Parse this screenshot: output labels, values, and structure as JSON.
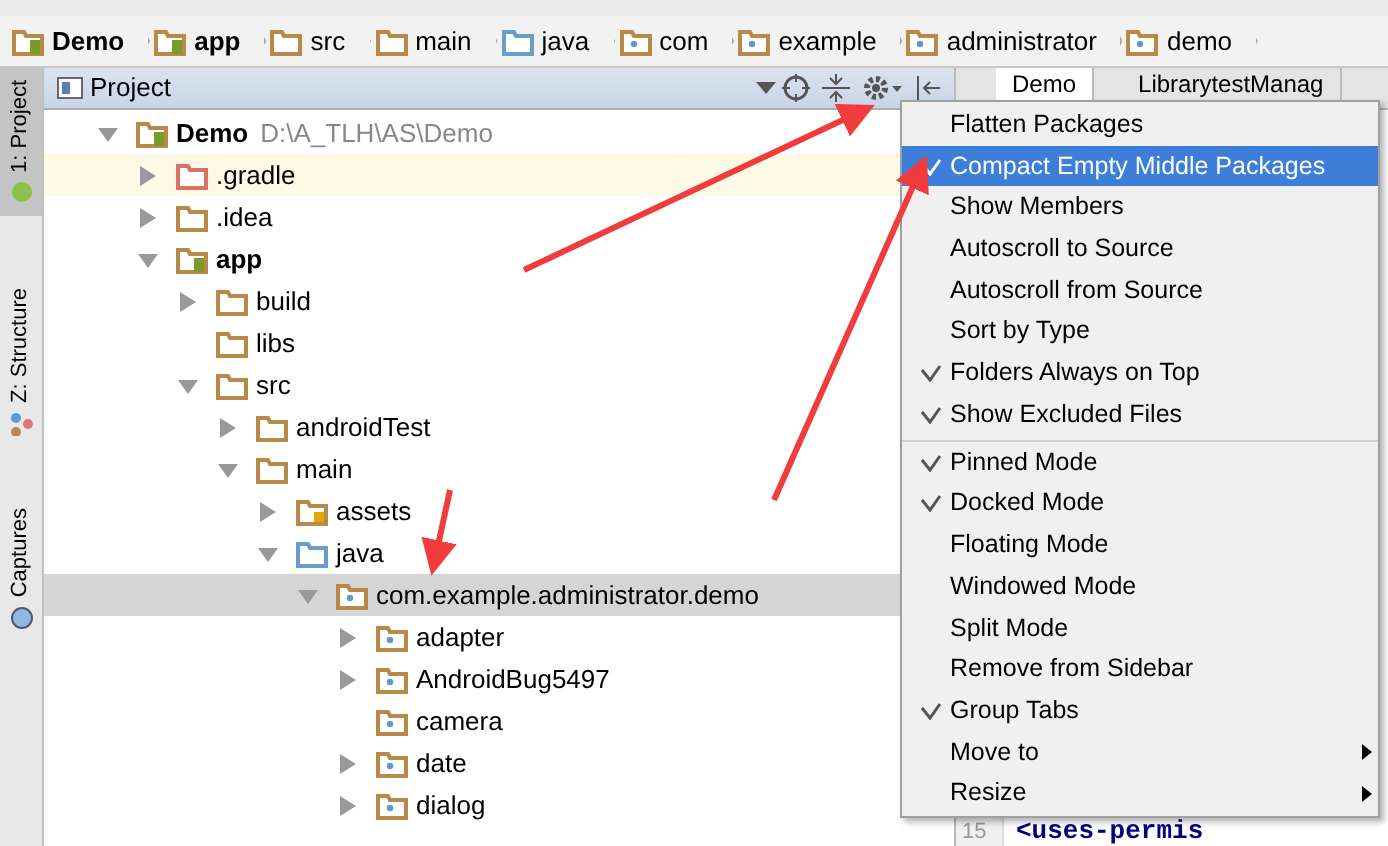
{
  "breadcrumbs": [
    {
      "label": "Demo",
      "kind": "module",
      "bold": true
    },
    {
      "label": "app",
      "kind": "module",
      "bold": true
    },
    {
      "label": "src",
      "kind": "folder",
      "bold": false
    },
    {
      "label": "main",
      "kind": "folder",
      "bold": false
    },
    {
      "label": "java",
      "kind": "source",
      "bold": false
    },
    {
      "label": "com",
      "kind": "package",
      "bold": false
    },
    {
      "label": "example",
      "kind": "package",
      "bold": false
    },
    {
      "label": "administrator",
      "kind": "package",
      "bold": false
    },
    {
      "label": "demo",
      "kind": "package",
      "bold": false
    }
  ],
  "tool_strip": [
    {
      "label": "1: Project",
      "kind": "android",
      "selected": true
    },
    {
      "label": "Z: Structure",
      "kind": "structure",
      "selected": false
    },
    {
      "label": "Captures",
      "kind": "captures",
      "selected": false
    }
  ],
  "project_panel": {
    "title": "Project",
    "tree": [
      {
        "label": "Demo",
        "path": "D:\\A_TLH\\AS\\Demo",
        "kind": "module",
        "bold": true,
        "expanded": true,
        "selected": false,
        "highlighted": false,
        "children": [
          {
            "label": ".gradle",
            "kind": "excluded",
            "bold": false,
            "expanded": false,
            "selected": false,
            "highlighted": true
          },
          {
            "label": ".idea",
            "kind": "folder",
            "bold": false,
            "expanded": false,
            "selected": false,
            "highlighted": false
          },
          {
            "label": "app",
            "kind": "module",
            "bold": true,
            "expanded": true,
            "selected": false,
            "highlighted": false,
            "children": [
              {
                "label": "build",
                "kind": "folder",
                "bold": false,
                "expanded": false,
                "selected": false,
                "highlighted": false
              },
              {
                "label": "libs",
                "kind": "folder",
                "bold": false,
                "selected": false,
                "highlighted": false
              },
              {
                "label": "src",
                "kind": "folder",
                "bold": false,
                "expanded": true,
                "selected": false,
                "highlighted": false,
                "children": [
                  {
                    "label": "androidTest",
                    "kind": "folder",
                    "bold": false,
                    "expanded": false,
                    "selected": false,
                    "highlighted": false
                  },
                  {
                    "label": "main",
                    "kind": "folder",
                    "bold": false,
                    "expanded": true,
                    "selected": false,
                    "highlighted": false,
                    "children": [
                      {
                        "label": "assets",
                        "kind": "assets",
                        "bold": false,
                        "expanded": false,
                        "selected": false,
                        "highlighted": false
                      },
                      {
                        "label": "java",
                        "kind": "source",
                        "bold": false,
                        "expanded": true,
                        "selected": false,
                        "highlighted": false,
                        "children": [
                          {
                            "label": "com.example.administrator.demo",
                            "kind": "package",
                            "bold": false,
                            "expanded": true,
                            "selected": true,
                            "highlighted": false,
                            "children": [
                              {
                                "label": "adapter",
                                "kind": "package",
                                "bold": false,
                                "expanded": false,
                                "selected": false,
                                "highlighted": false
                              },
                              {
                                "label": "AndroidBug5497",
                                "kind": "package",
                                "bold": false,
                                "expanded": false,
                                "selected": false,
                                "highlighted": false
                              },
                              {
                                "label": "camera",
                                "kind": "package",
                                "bold": false,
                                "selected": false,
                                "highlighted": false
                              },
                              {
                                "label": "date",
                                "kind": "package",
                                "bold": false,
                                "expanded": false,
                                "selected": false,
                                "highlighted": false
                              },
                              {
                                "label": "dialog",
                                "kind": "package",
                                "bold": false,
                                "expanded": false,
                                "selected": false,
                                "highlighted": false
                              }
                            ]
                          }
                        ]
                      }
                    ]
                  }
                ]
              }
            ]
          }
        ]
      }
    ]
  },
  "editor": {
    "tabs": [
      {
        "label": "Demo",
        "selected": true
      },
      {
        "label": "LibrarytestManag",
        "selected": false
      }
    ],
    "line_number": "15",
    "code_line": "<uses-permis"
  },
  "menu": [
    {
      "label": "Flatten Packages",
      "checked": false,
      "selected": false,
      "separator_before": false,
      "submenu": false
    },
    {
      "label": "Compact Empty Middle Packages",
      "checked": true,
      "selected": true,
      "separator_before": false,
      "submenu": false
    },
    {
      "label": "Show Members",
      "checked": false,
      "selected": false,
      "separator_before": false,
      "submenu": false
    },
    {
      "label": "Autoscroll to Source",
      "checked": false,
      "selected": false,
      "separator_before": false,
      "submenu": false
    },
    {
      "label": "Autoscroll from Source",
      "checked": false,
      "selected": false,
      "separator_before": false,
      "submenu": false
    },
    {
      "label": "Sort by Type",
      "checked": false,
      "selected": false,
      "separator_before": false,
      "submenu": false
    },
    {
      "label": "Folders Always on Top",
      "checked": true,
      "selected": false,
      "separator_before": false,
      "submenu": false
    },
    {
      "label": "Show Excluded Files",
      "checked": true,
      "selected": false,
      "separator_before": false,
      "submenu": false
    },
    {
      "label": "Pinned Mode",
      "checked": true,
      "selected": false,
      "separator_before": true,
      "submenu": false
    },
    {
      "label": "Docked Mode",
      "checked": true,
      "selected": false,
      "separator_before": false,
      "submenu": false
    },
    {
      "label": "Floating Mode",
      "checked": false,
      "selected": false,
      "separator_before": false,
      "submenu": false
    },
    {
      "label": "Windowed Mode",
      "checked": false,
      "selected": false,
      "separator_before": false,
      "submenu": false
    },
    {
      "label": "Split Mode",
      "checked": false,
      "selected": false,
      "separator_before": false,
      "submenu": false
    },
    {
      "label": "Remove from Sidebar",
      "checked": false,
      "selected": false,
      "separator_before": false,
      "submenu": false
    },
    {
      "label": "Group Tabs",
      "checked": true,
      "selected": false,
      "separator_before": false,
      "submenu": false
    },
    {
      "label": "Move to",
      "checked": false,
      "selected": false,
      "separator_before": false,
      "submenu": true
    },
    {
      "label": "Resize",
      "checked": false,
      "selected": false,
      "separator_before": false,
      "submenu": true
    }
  ]
}
